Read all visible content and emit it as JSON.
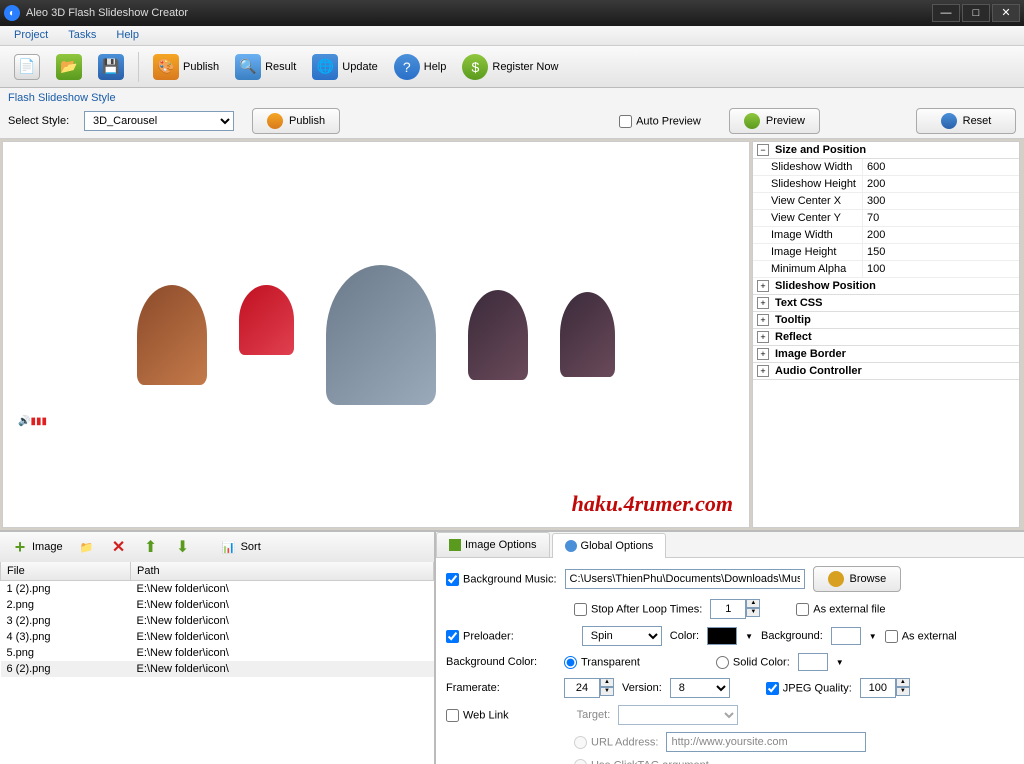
{
  "title": "Aleo 3D Flash Slideshow Creator",
  "menu": {
    "project": "Project",
    "tasks": "Tasks",
    "help": "Help"
  },
  "toolbar": {
    "publish": "Publish",
    "result": "Result",
    "update": "Update",
    "help": "Help",
    "register": "Register Now"
  },
  "style": {
    "heading": "Flash Slideshow Style",
    "select_label": "Select Style:",
    "select_value": "3D_Carousel",
    "publish": "Publish",
    "auto_preview": "Auto Preview",
    "preview": "Preview",
    "reset": "Reset"
  },
  "watermark": "haku.4rumer.com",
  "props": {
    "size_pos": "Size and Position",
    "rows": [
      {
        "label": "Slideshow Width",
        "value": "600"
      },
      {
        "label": "Slideshow Height",
        "value": "200"
      },
      {
        "label": "View Center X",
        "value": "300"
      },
      {
        "label": "View Center Y",
        "value": "70"
      },
      {
        "label": "Image Width",
        "value": "200"
      },
      {
        "label": "Image Height",
        "value": "150"
      },
      {
        "label": "Minimum Alpha",
        "value": "100"
      }
    ],
    "cats": [
      "Slideshow Position",
      "Text CSS",
      "Tooltip",
      "Reflect",
      "Image Border",
      "Audio Controller"
    ]
  },
  "file_toolbar": {
    "image": "Image",
    "sort": "Sort"
  },
  "file_cols": {
    "file": "File",
    "path": "Path"
  },
  "files": [
    {
      "file": "1 (2).png",
      "path": "E:\\New folder\\icon\\"
    },
    {
      "file": "2.png",
      "path": "E:\\New folder\\icon\\"
    },
    {
      "file": "3 (2).png",
      "path": "E:\\New folder\\icon\\"
    },
    {
      "file": "4 (3).png",
      "path": "E:\\New folder\\icon\\"
    },
    {
      "file": "5.png",
      "path": "E:\\New folder\\icon\\"
    },
    {
      "file": "6 (2).png",
      "path": "E:\\New folder\\icon\\"
    }
  ],
  "tabs": {
    "image_options": "Image Options",
    "global_options": "Global Options"
  },
  "options": {
    "bg_music": "Background Music:",
    "bg_music_value": "C:\\Users\\ThienPhu\\Documents\\Downloads\\Mus",
    "browse": "Browse",
    "stop_after": "Stop After Loop Times:",
    "stop_after_value": "1",
    "as_external": "As external file",
    "preloader": "Preloader:",
    "preloader_value": "Spin",
    "color": "Color:",
    "background": "Background:",
    "as_external2": "As external",
    "bg_color": "Background Color:",
    "transparent": "Transparent",
    "solid": "Solid Color:",
    "framerate": "Framerate:",
    "framerate_value": "24",
    "version": "Version:",
    "version_value": "8",
    "jpeg_quality": "JPEG Quality:",
    "jpeg_quality_value": "100",
    "web_link": "Web Link",
    "target": "Target:",
    "url_address": "URL Address:",
    "url_placeholder": "http://www.yoursite.com",
    "clicktag": "Use ClickTAG argument"
  }
}
